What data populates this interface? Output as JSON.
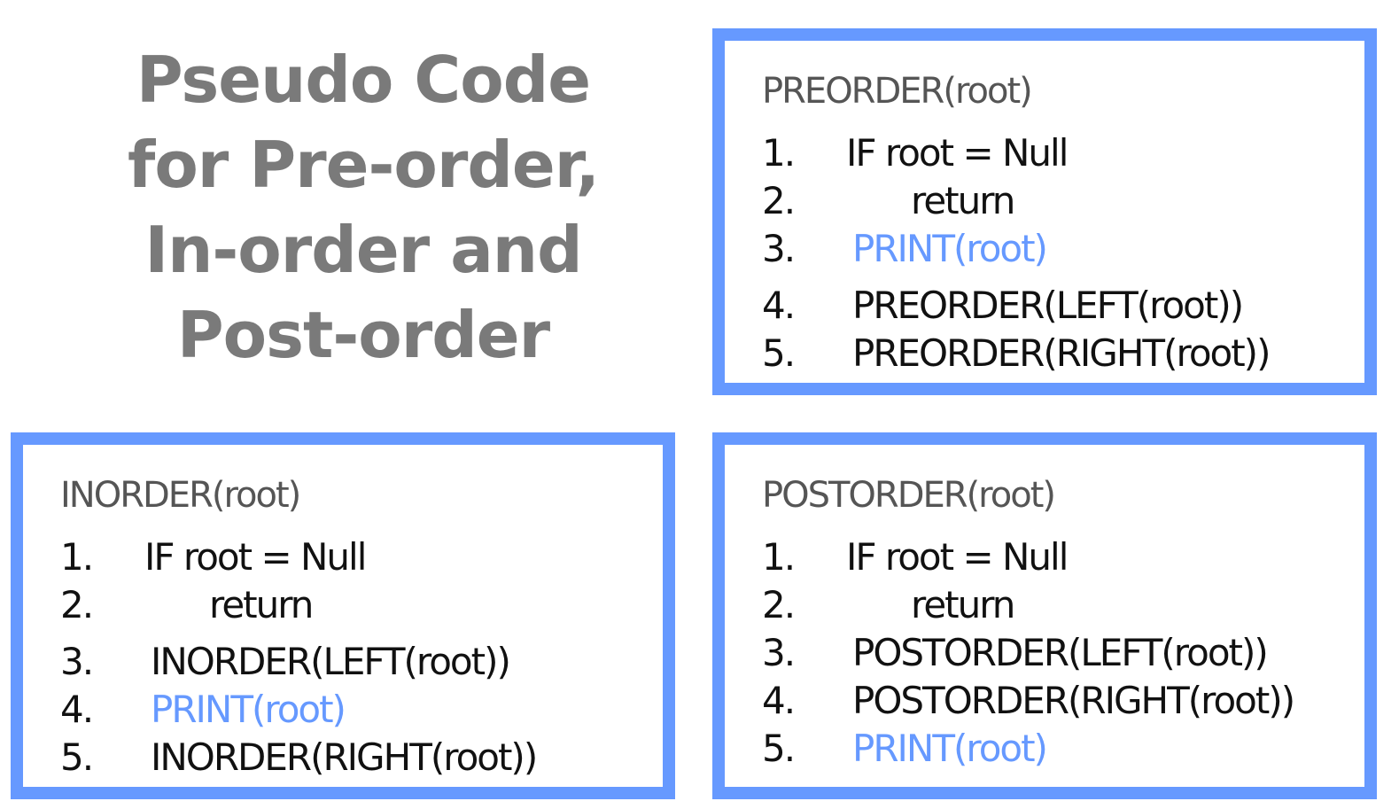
{
  "title": {
    "lines": [
      "Pseudo Code",
      "for Pre-order,",
      "In-order and",
      "Post-order"
    ]
  },
  "preorder": {
    "header": "PREORDER(root)",
    "lines": [
      {
        "num": "1.",
        "code": "IF root = Null"
      },
      {
        "num": "2.",
        "code": "return"
      },
      {
        "num": "3.",
        "code": "PRINT(root)"
      },
      {
        "num": "4.",
        "code": "PREORDER(LEFT(root))"
      },
      {
        "num": "5.",
        "code": "PREORDER(RIGHT(root))"
      }
    ]
  },
  "inorder": {
    "header": "INORDER(root)",
    "lines": [
      {
        "num": "1.",
        "code": "IF root = Null"
      },
      {
        "num": "2.",
        "code": "return"
      },
      {
        "num": "3.",
        "code": "INORDER(LEFT(root))"
      },
      {
        "num": "4.",
        "code": "PRINT(root)"
      },
      {
        "num": "5.",
        "code": "INORDER(RIGHT(root))"
      }
    ]
  },
  "postorder": {
    "header": "POSTORDER(root)",
    "lines": [
      {
        "num": "1.",
        "code": "IF root = Null"
      },
      {
        "num": "2.",
        "code": "return"
      },
      {
        "num": "3.",
        "code": "POSTORDER(LEFT(root))"
      },
      {
        "num": "4.",
        "code": "POSTORDER(RIGHT(root))"
      },
      {
        "num": "5.",
        "code": "PRINT(root)"
      }
    ]
  },
  "colors": {
    "border": "#6699ff",
    "highlight": "#6699ff",
    "title": "#7a7a7a"
  }
}
